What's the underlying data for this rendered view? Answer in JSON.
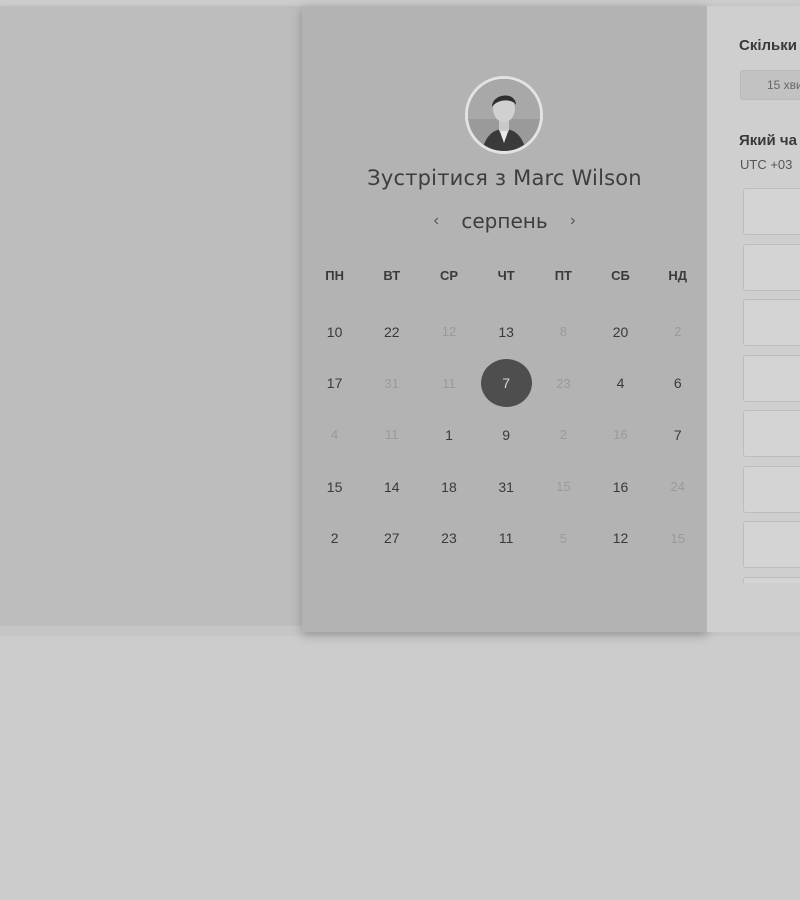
{
  "header": {
    "title": "Зустрітися з Marc Wilson"
  },
  "avatar": {
    "icon": "person-avatar-icon"
  },
  "calendar": {
    "month": "серпень",
    "prev_icon": "‹",
    "next_icon": "›",
    "weekdays": [
      "ПН",
      "ВТ",
      "СР",
      "ЧТ",
      "ПТ",
      "СБ",
      "НД"
    ],
    "weeks": [
      [
        {
          "d": "10",
          "m": false
        },
        {
          "d": "22",
          "m": false
        },
        {
          "d": "12",
          "m": true
        },
        {
          "d": "13",
          "m": false
        },
        {
          "d": "8",
          "m": true
        },
        {
          "d": "20",
          "m": false
        },
        {
          "d": "2",
          "m": true
        }
      ],
      [
        {
          "d": "17",
          "m": false
        },
        {
          "d": "31",
          "m": true
        },
        {
          "d": "11",
          "m": true
        },
        {
          "d": "7",
          "m": false,
          "sel": true
        },
        {
          "d": "23",
          "m": true
        },
        {
          "d": "4",
          "m": false
        },
        {
          "d": "6",
          "m": false
        }
      ],
      [
        {
          "d": "4",
          "m": true
        },
        {
          "d": "11",
          "m": true
        },
        {
          "d": "1",
          "m": false
        },
        {
          "d": "9",
          "m": false
        },
        {
          "d": "2",
          "m": true
        },
        {
          "d": "16",
          "m": true
        },
        {
          "d": "7",
          "m": false
        }
      ],
      [
        {
          "d": "15",
          "m": false
        },
        {
          "d": "14",
          "m": false
        },
        {
          "d": "18",
          "m": false
        },
        {
          "d": "31",
          "m": false
        },
        {
          "d": "15",
          "m": true
        },
        {
          "d": "16",
          "m": false
        },
        {
          "d": "24",
          "m": true
        }
      ],
      [
        {
          "d": "2",
          "m": false
        },
        {
          "d": "27",
          "m": false
        },
        {
          "d": "23",
          "m": false
        },
        {
          "d": "11",
          "m": false
        },
        {
          "d": "5",
          "m": true
        },
        {
          "d": "12",
          "m": false
        },
        {
          "d": "15",
          "m": true
        }
      ]
    ]
  },
  "right_panel": {
    "duration_title": "Скільки",
    "duration_value": "15 хви",
    "time_title": "Який ча",
    "timezone": "UTC +03",
    "slot_count": 8
  },
  "colors": {
    "selected_day": "#4e4e4e",
    "panel_bg": "#b3b3b3"
  }
}
